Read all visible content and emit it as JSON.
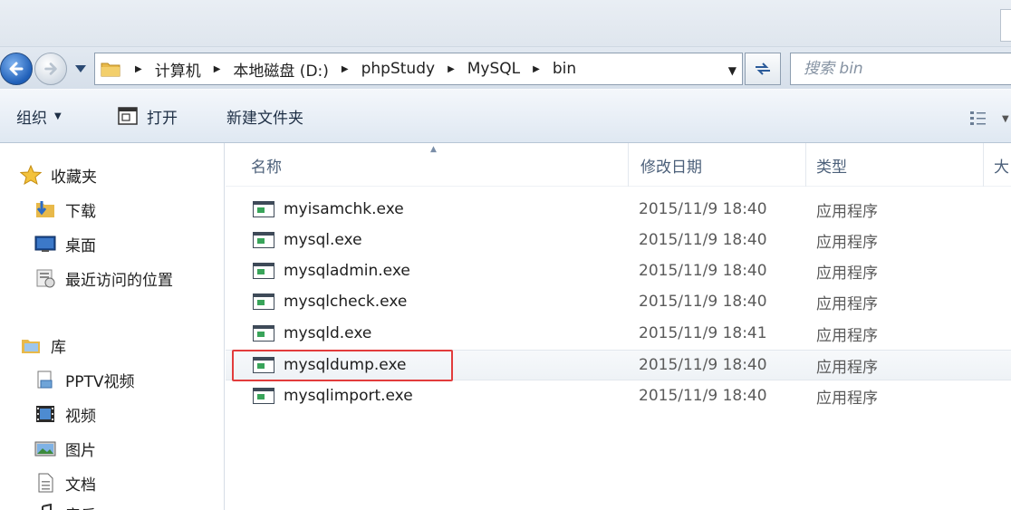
{
  "window": {
    "address": {
      "crumbs": [
        "计算机",
        "本地磁盘 (D:)",
        "phpStudy",
        "MySQL",
        "bin"
      ]
    },
    "search": {
      "placeholder": "搜索 bin"
    }
  },
  "toolbar": {
    "organize_label": "组织",
    "open_label": "打开",
    "new_folder_label": "新建文件夹"
  },
  "sidebar": {
    "favorites_label": "收藏夹",
    "favorites": [
      "下载",
      "桌面",
      "最近访问的位置"
    ],
    "libraries_label": "库",
    "libraries": [
      "PPTV视频",
      "视频",
      "图片",
      "文档",
      "音乐"
    ]
  },
  "columns": {
    "name": "名称",
    "modified": "修改日期",
    "type": "类型",
    "size": "大"
  },
  "files": [
    {
      "name": "myisamchk.exe",
      "modified": "2015/11/9 18:40",
      "type": "应用程序"
    },
    {
      "name": "mysql.exe",
      "modified": "2015/11/9 18:40",
      "type": "应用程序"
    },
    {
      "name": "mysqladmin.exe",
      "modified": "2015/11/9 18:40",
      "type": "应用程序"
    },
    {
      "name": "mysqlcheck.exe",
      "modified": "2015/11/9 18:40",
      "type": "应用程序"
    },
    {
      "name": "mysqld.exe",
      "modified": "2015/11/9 18:41",
      "type": "应用程序"
    },
    {
      "name": "mysqldump.exe",
      "modified": "2015/11/9 18:40",
      "type": "应用程序"
    },
    {
      "name": "mysqlimport.exe",
      "modified": "2015/11/9 18:40",
      "type": "应用程序"
    }
  ],
  "colors": {
    "highlight": "#e23c3c",
    "accent": "#1f5fb8"
  }
}
